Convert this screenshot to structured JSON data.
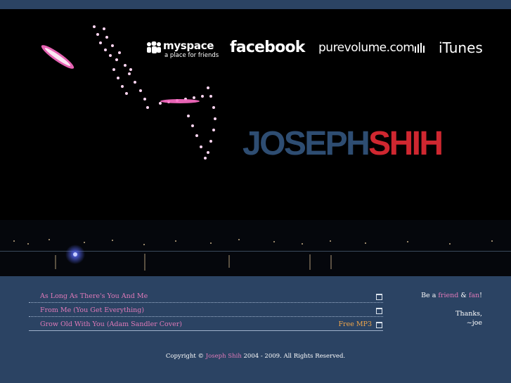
{
  "social": {
    "myspace_name": "myspace",
    "myspace_tagline": "a place for friends",
    "facebook": "facebook",
    "purevolume": "purevolume.com",
    "itunes": "iTunes"
  },
  "brand": {
    "first": "JOSEPH",
    "last": "SHIH"
  },
  "tracks": [
    {
      "title": "As Long As There's You And Me",
      "extra": ""
    },
    {
      "title": "From Me (You Get Everything)",
      "extra": ""
    },
    {
      "title": "Grow Old With You (Adam Sandler Cover)",
      "extra": "Free MP3"
    }
  ],
  "sidebar": {
    "be_a": "Be a",
    "friend": "friend",
    "amp": "&",
    "fan": "fan",
    "excl": "!",
    "thanks": "Thanks,",
    "signature": "~joe"
  },
  "footer": {
    "prefix": "Copyright ©",
    "name": "Joseph Shih",
    "suffix": "2004 - 2009. All Rights Reserved."
  },
  "colors": {
    "background": "#2b4363",
    "link": "#e07ab9",
    "accent": "#f0a64a",
    "brand_blue": "#2e4d72",
    "brand_red": "#cf2730"
  }
}
